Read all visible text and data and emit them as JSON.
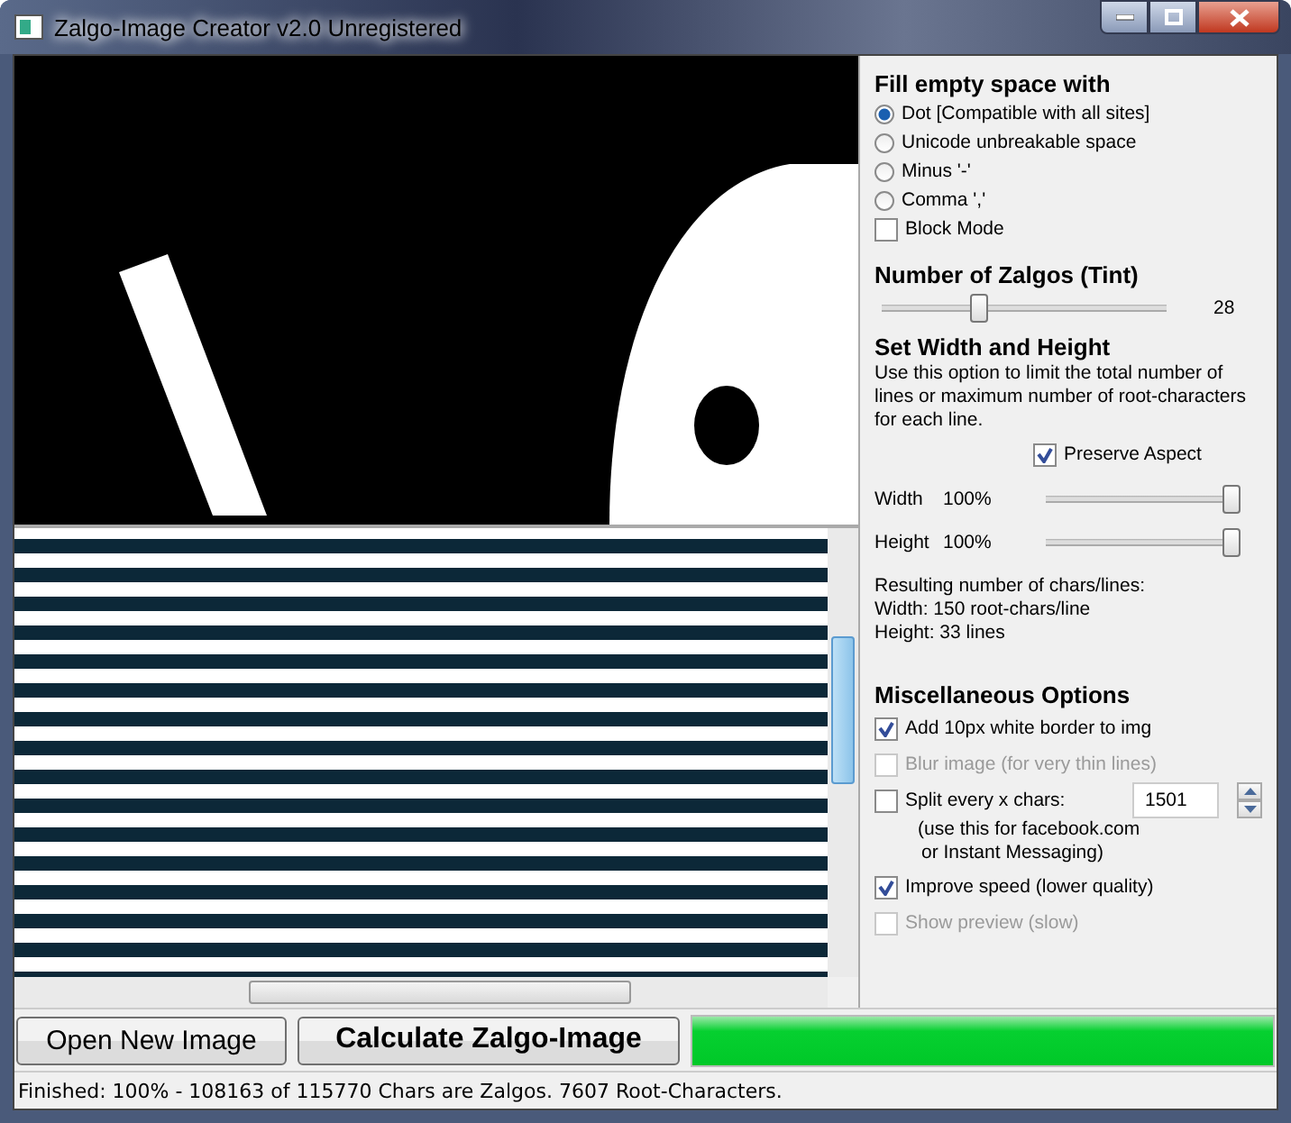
{
  "window": {
    "title": "Zalgo-Image Creator v2.0 Unregistered"
  },
  "fill_section": {
    "heading": "Fill empty space with",
    "options": [
      {
        "label": "Dot [Compatible with all sites]",
        "selected": true
      },
      {
        "label": "Unicode unbreakable space",
        "selected": false
      },
      {
        "label": "Minus '-'",
        "selected": false
      },
      {
        "label": "Comma ','",
        "selected": false
      }
    ],
    "block_mode": {
      "label": "Block Mode",
      "checked": false
    }
  },
  "zalgo_section": {
    "heading": "Number of Zalgos (Tint)",
    "slider": {
      "level": 0.33
    },
    "reading": "28"
  },
  "size_section": {
    "heading": "Set Width and Height",
    "description": "Use this option to limit the total number of lines or maximum number of root-characters for each line.",
    "preserve_aspect": {
      "label": "Preserve Aspect",
      "checked": true
    },
    "sliders": [
      {
        "label": "Width",
        "reading": "100%",
        "level": 1
      },
      {
        "label": "Height",
        "reading": "100%",
        "level": 1
      }
    ],
    "result_lines": [
      "Resulting number of chars/lines:",
      "Width: 150 root-chars/line",
      "Height: 33 lines"
    ]
  },
  "misc_section": {
    "heading": "Miscellaneous Options",
    "options": [
      {
        "kind": "check",
        "label": "Add 10px white border to img",
        "checked": true,
        "disabled": false
      },
      {
        "kind": "check",
        "label": "Blur image (for very thin lines)",
        "checked": false,
        "disabled": true
      },
      {
        "kind": "split",
        "label": "Split every x chars:",
        "checked": false,
        "disabled": false,
        "value": "1501"
      },
      {
        "kind": "note",
        "lines": [
          "(use this for facebook.com",
          "or Instant Messaging)"
        ]
      },
      {
        "kind": "check",
        "label": "Improve speed (lower quality)",
        "checked": true,
        "disabled": false
      },
      {
        "kind": "check",
        "label": "Show preview (slow)",
        "checked": false,
        "disabled": true
      }
    ]
  },
  "buttons": [
    {
      "label": "Open New Image",
      "bold": false
    },
    {
      "label": "Calculate Zalgo-Image",
      "bold": true
    }
  ],
  "progress": {
    "level": 1
  },
  "status_bar": "Finished: 100% - 108163 of 115770 Chars are Zalgos. 7607 Root-Characters."
}
